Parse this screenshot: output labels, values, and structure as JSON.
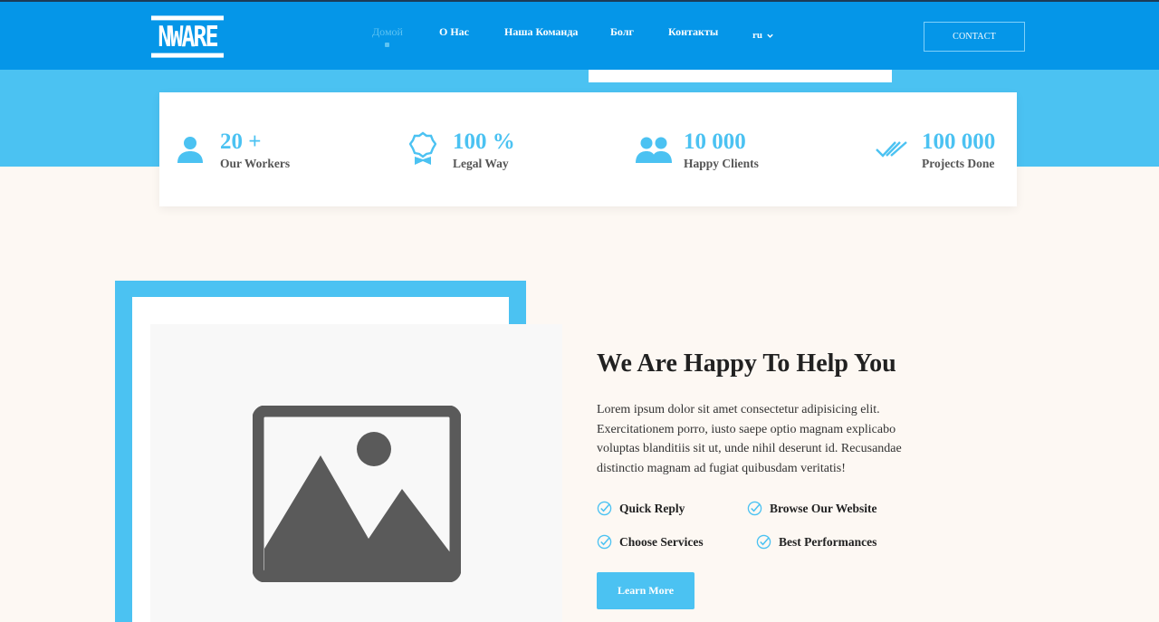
{
  "header": {
    "logo": "NWARE",
    "nav": [
      "Домой",
      "О Нас",
      "Наша Команда",
      "Болг",
      "Контакты"
    ],
    "language": "ru",
    "contact_label": "CONTACT"
  },
  "stats": [
    {
      "icon": "user-icon",
      "value": "20 +",
      "label": "Our Workers"
    },
    {
      "icon": "award-badge-icon",
      "value": "100 %",
      "label": "Legal Way"
    },
    {
      "icon": "users-icon",
      "value": "10 000",
      "label": "Happy Clients"
    },
    {
      "icon": "double-check-icon",
      "value": "100 000",
      "label": "Projects Done"
    }
  ],
  "about": {
    "title": "We Are Happy To Help You",
    "text": "Lorem ipsum dolor sit amet consectetur adipisicing elit. Exercitationem porro, iusto saepe optio magnam explicabo voluptas blanditiis sit ut, unde nihil deserunt id. Recusandae distinctio magnam ad fugiat quibusdam veritatis!",
    "features": [
      "Quick Reply",
      "Browse Our Website",
      "Choose Services",
      "Best Performances"
    ],
    "button_label": "Learn More",
    "image_icon": "image-placeholder-icon"
  },
  "colors": {
    "header_bg": "#0596e8",
    "accent": "#4bc2f2",
    "page_bg": "#fdf8f3"
  }
}
